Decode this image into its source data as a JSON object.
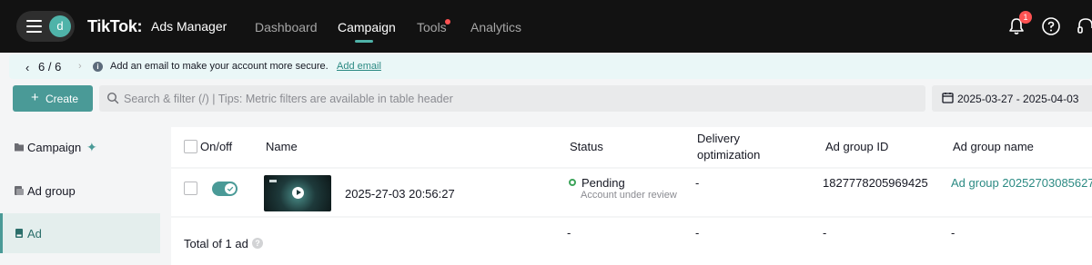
{
  "header": {
    "avatar_initial": "d",
    "logo_main": "TikTok:",
    "logo_sub": "Ads Manager",
    "nav": [
      "Dashboard",
      "Campaign",
      "Tools",
      "Analytics"
    ],
    "active_nav": "Campaign",
    "notification_count": "1"
  },
  "notice": {
    "pager": "6 / 6",
    "message": "Add an email to make your account more secure.",
    "link": "Add email"
  },
  "toolbar": {
    "create_label": "Create",
    "search_placeholder": "Search & filter (/) | Tips: Metric filters are available in table header",
    "date_range": "2025-03-27 - 2025-04-03"
  },
  "sidebar": {
    "items": [
      {
        "label": "Campaign"
      },
      {
        "label": "Ad group"
      },
      {
        "label": "Ad"
      }
    ],
    "active": "Ad"
  },
  "table": {
    "columns": {
      "onoff": "On/off",
      "name": "Name",
      "status": "Status",
      "delivery_1": "Delivery",
      "delivery_2": "optimization",
      "adgroup_id": "Ad group ID",
      "adgroup_name": "Ad group name"
    },
    "rows": [
      {
        "enabled": true,
        "name": "2025-27-03 20:56:27",
        "status": "Pending",
        "status_detail": "Account under review",
        "delivery": "-",
        "adgroup_id": "1827778205969425",
        "adgroup_name": "Ad group 20252703085627"
      }
    ],
    "footer": {
      "total": "Total of 1 ad",
      "status": "-",
      "delivery": "-",
      "adgroup_id": "-",
      "adgroup_name": "-"
    }
  },
  "colors": {
    "accent": "#4a9a97",
    "topbar": "#121212",
    "badge": "#fe5252",
    "pending": "#3da45a"
  }
}
